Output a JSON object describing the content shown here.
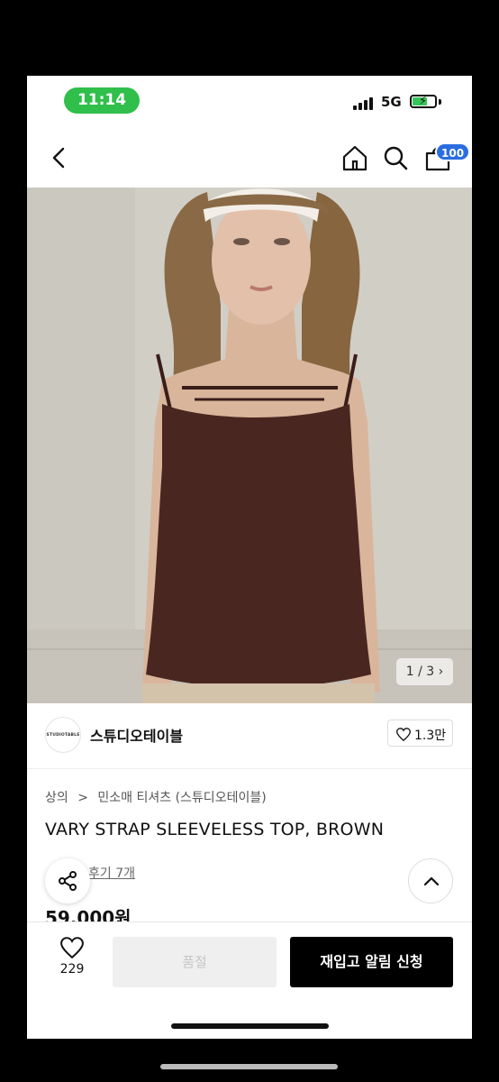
{
  "status_bar": {
    "time": "11:14",
    "network": "5G",
    "time_pill_color": "#2fbf4a"
  },
  "header": {
    "cart_count": "100",
    "icons": [
      "back-icon",
      "home-icon",
      "search-icon",
      "cart-icon"
    ]
  },
  "gallery": {
    "counter": "1 / 3",
    "counter_icon": "chevron-right-icon"
  },
  "brand": {
    "logo_text": "STUDIOTABLE",
    "name": "스튜디오테이블",
    "likes": "1.3만"
  },
  "breadcrumb": {
    "category": "상의",
    "separator": ">",
    "subcategory": "민소매 티셔츠 (스튜디오테이블)"
  },
  "product": {
    "title": "VARY STRAP SLEEVELESS TOP, BROWN",
    "reviews": "후기 7개",
    "price": "59,000원"
  },
  "bottom_bar": {
    "wish_count": "229",
    "soldout_label": "품절",
    "restock_label": "재입고 알림 신청"
  },
  "colors": {
    "accent_badge": "#2b6de0",
    "garment": "#4a2620",
    "button_dark": "#000000"
  }
}
